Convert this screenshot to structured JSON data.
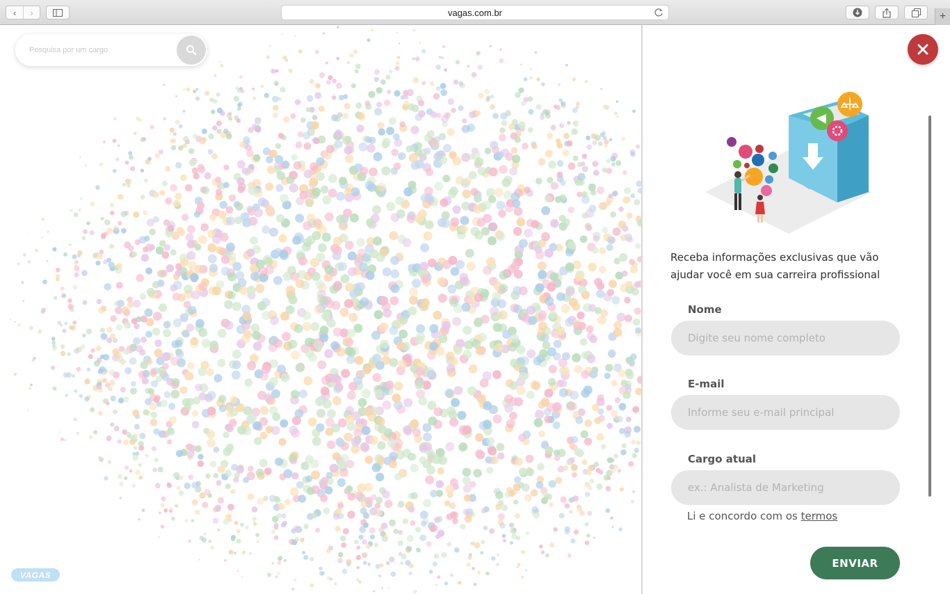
{
  "browser": {
    "url": "vagas.com.br",
    "back_glyph": "‹",
    "forward_glyph": "›",
    "new_tab_glyph": "+"
  },
  "search": {
    "placeholder": "Pesquisa por um cargo",
    "icon": "search-icon"
  },
  "logo": {
    "text": "VAGAS"
  },
  "colors": {
    "close_button": "#c0393b",
    "submit_button": "#3d7a58",
    "bubbles": [
      "#f4b6c8",
      "#f9d4a8",
      "#b8dcb9",
      "#a9cde8",
      "#f7c2d6",
      "#fce1b8",
      "#c9e4c4",
      "#c3d6ee",
      "#e6c7e8",
      "#d6ecd2"
    ]
  },
  "panel": {
    "intro": "Receba informações exclusivas que vão ajudar você em sua carreira profissional",
    "fields": [
      {
        "label": "Nome",
        "placeholder": "Digite seu nome completo"
      },
      {
        "label": "E-mail",
        "placeholder": "Informe seu e-mail principal"
      },
      {
        "label": "Cargo atual",
        "placeholder": "ex.: Analista de Marketing"
      }
    ],
    "terms_prefix": "Li e concordo com os",
    "terms_link": "termos",
    "submit_label": "ENVIAR",
    "close_icon": "close-icon"
  }
}
